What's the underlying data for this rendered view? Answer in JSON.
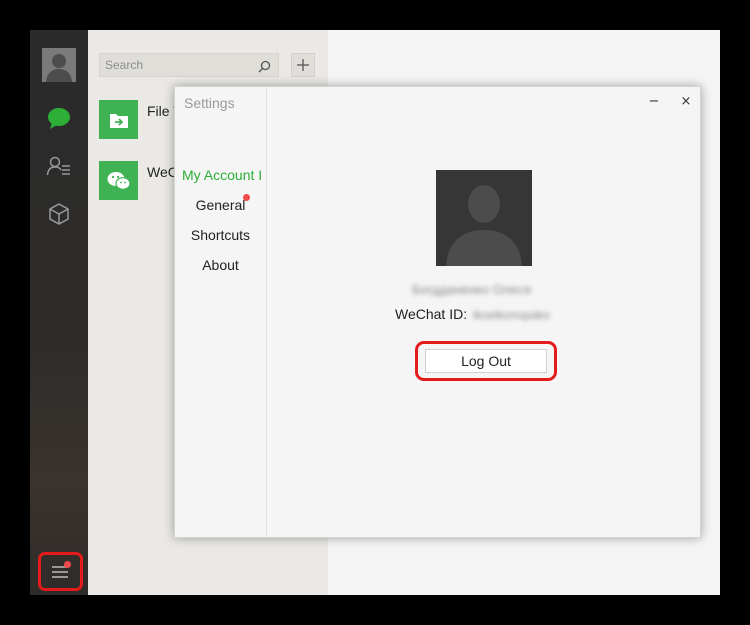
{
  "sidebar": {
    "icons": [
      "avatar",
      "chat-icon",
      "contacts-icon",
      "favorites-box-icon",
      "menu-icon"
    ],
    "accent": "#2dae36",
    "highlight_color": "#e31b1b",
    "badge_color": "#f04a4a"
  },
  "chatlist": {
    "search_placeholder": "Search",
    "add_label": "+",
    "items": [
      {
        "name": "File T",
        "icon": "file-transfer-icon"
      },
      {
        "name": "WeC",
        "icon": "wechat-icon"
      }
    ]
  },
  "settings": {
    "title": "Settings",
    "minimize_label": "−",
    "close_label": "×",
    "nav": [
      "My Account I",
      "General",
      "Shortcuts",
      "About"
    ],
    "account": {
      "name": "Богдданенко Олеся",
      "wechat_id_label": "WeChat ID:",
      "wechat_id_value": "ikoelkonopako",
      "logout_label": "Log Out"
    }
  }
}
